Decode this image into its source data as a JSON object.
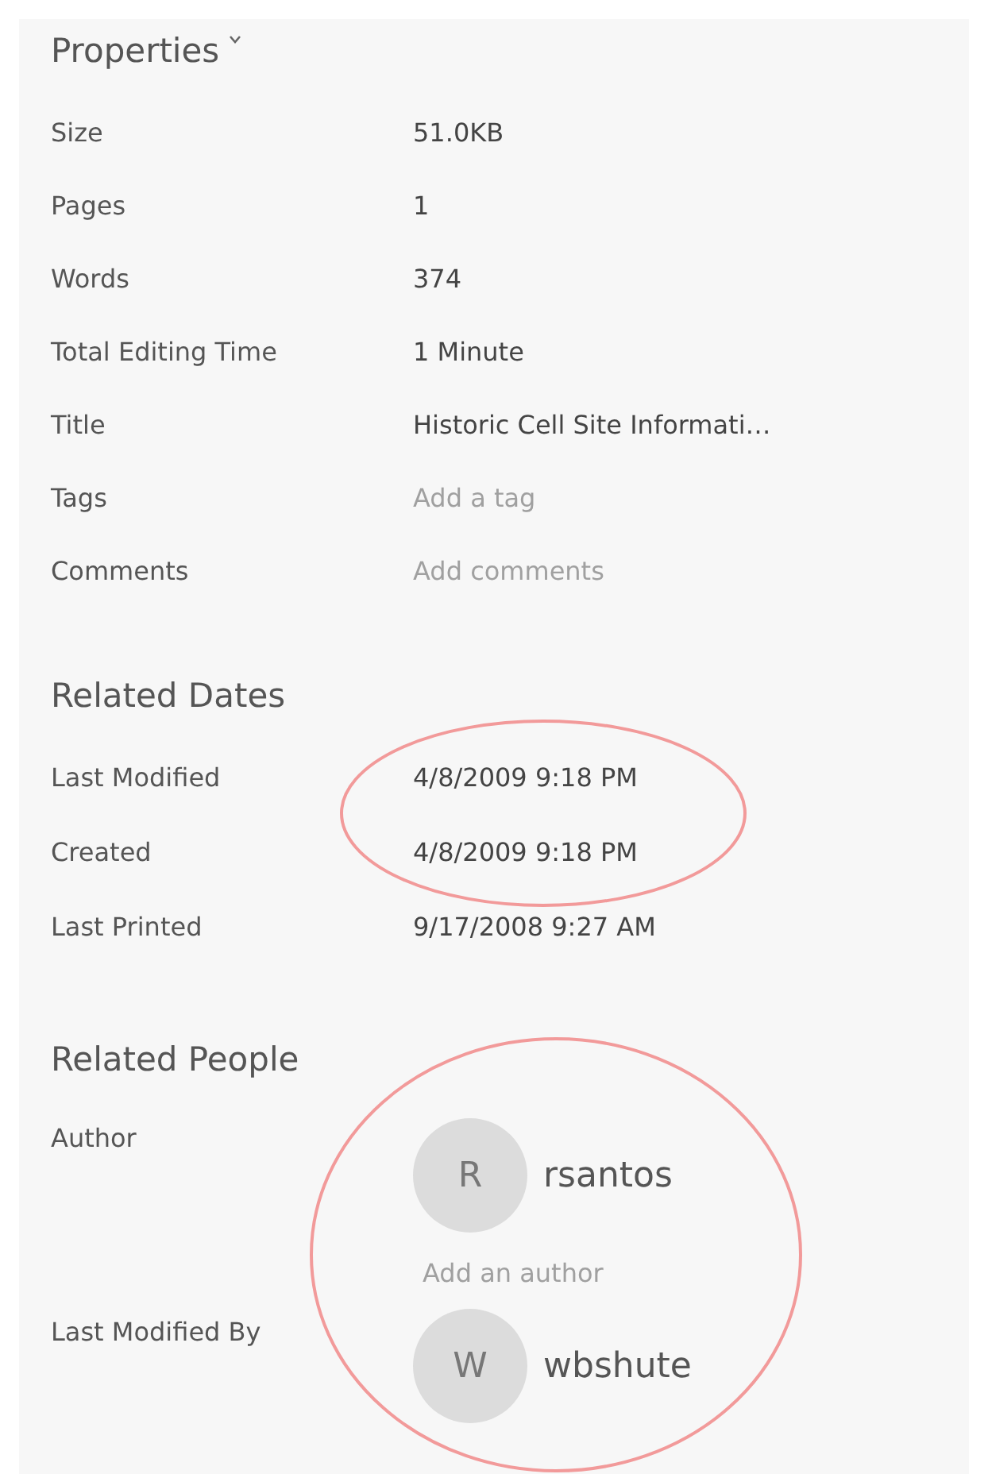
{
  "properties": {
    "title": "Properties",
    "rows": [
      {
        "label": "Size",
        "value": "51.0KB"
      },
      {
        "label": "Pages",
        "value": "1"
      },
      {
        "label": "Words",
        "value": "374"
      },
      {
        "label": "Total Editing Time",
        "value": "1 Minute"
      },
      {
        "label": "Title",
        "value": "Historic Cell Site Informati…"
      },
      {
        "label": "Tags",
        "placeholder": "Add a tag"
      },
      {
        "label": "Comments",
        "placeholder": "Add comments"
      }
    ]
  },
  "related_dates": {
    "title": "Related Dates",
    "rows": [
      {
        "label": "Last Modified",
        "value": "4/8/2009 9:18 PM"
      },
      {
        "label": "Created",
        "value": "4/8/2009 9:18 PM"
      },
      {
        "label": "Last Printed",
        "value": "9/17/2008 9:27 AM"
      }
    ]
  },
  "related_people": {
    "title": "Related People",
    "author": {
      "label": "Author",
      "people": [
        {
          "initial": "R",
          "name": "rsantos"
        }
      ],
      "add_placeholder": "Add an author"
    },
    "last_modified_by": {
      "label": "Last Modified By",
      "people": [
        {
          "initial": "W",
          "name": "wbshute"
        }
      ]
    }
  }
}
